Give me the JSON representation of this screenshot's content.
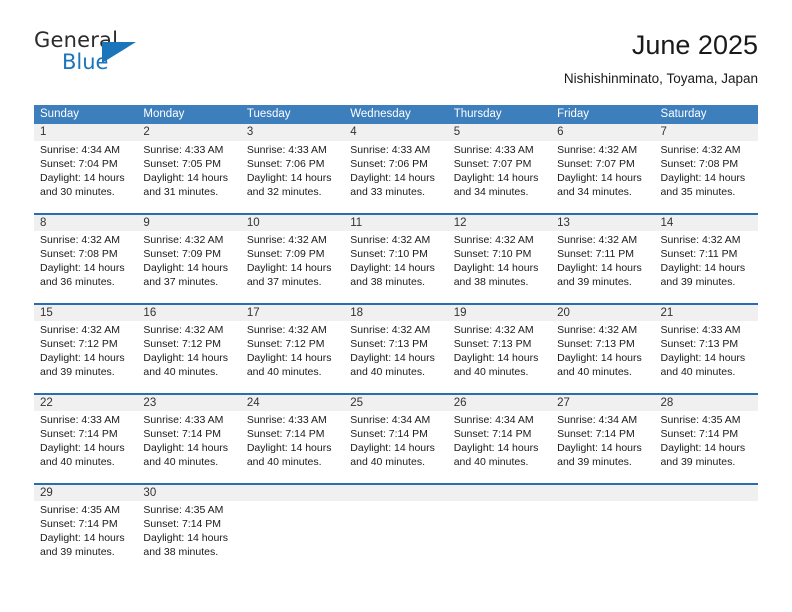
{
  "brand": {
    "name_part1": "General",
    "name_part2": "Blue",
    "accent_color": "#1b75bb"
  },
  "header": {
    "month_title": "June 2025",
    "location": "Nishishinminato, Toyama, Japan"
  },
  "calendar": {
    "header_bg": "#3d7ebd",
    "daynum_bg": "#f0f0f0",
    "row_divider": "#2a6db0",
    "weekdays": [
      "Sunday",
      "Monday",
      "Tuesday",
      "Wednesday",
      "Thursday",
      "Friday",
      "Saturday"
    ],
    "weeks": [
      {
        "days": [
          {
            "num": "1",
            "sunrise": "Sunrise: 4:34 AM",
            "sunset": "Sunset: 7:04 PM",
            "daylight1": "Daylight: 14 hours",
            "daylight2": "and 30 minutes."
          },
          {
            "num": "2",
            "sunrise": "Sunrise: 4:33 AM",
            "sunset": "Sunset: 7:05 PM",
            "daylight1": "Daylight: 14 hours",
            "daylight2": "and 31 minutes."
          },
          {
            "num": "3",
            "sunrise": "Sunrise: 4:33 AM",
            "sunset": "Sunset: 7:06 PM",
            "daylight1": "Daylight: 14 hours",
            "daylight2": "and 32 minutes."
          },
          {
            "num": "4",
            "sunrise": "Sunrise: 4:33 AM",
            "sunset": "Sunset: 7:06 PM",
            "daylight1": "Daylight: 14 hours",
            "daylight2": "and 33 minutes."
          },
          {
            "num": "5",
            "sunrise": "Sunrise: 4:33 AM",
            "sunset": "Sunset: 7:07 PM",
            "daylight1": "Daylight: 14 hours",
            "daylight2": "and 34 minutes."
          },
          {
            "num": "6",
            "sunrise": "Sunrise: 4:32 AM",
            "sunset": "Sunset: 7:07 PM",
            "daylight1": "Daylight: 14 hours",
            "daylight2": "and 34 minutes."
          },
          {
            "num": "7",
            "sunrise": "Sunrise: 4:32 AM",
            "sunset": "Sunset: 7:08 PM",
            "daylight1": "Daylight: 14 hours",
            "daylight2": "and 35 minutes."
          }
        ]
      },
      {
        "days": [
          {
            "num": "8",
            "sunrise": "Sunrise: 4:32 AM",
            "sunset": "Sunset: 7:08 PM",
            "daylight1": "Daylight: 14 hours",
            "daylight2": "and 36 minutes."
          },
          {
            "num": "9",
            "sunrise": "Sunrise: 4:32 AM",
            "sunset": "Sunset: 7:09 PM",
            "daylight1": "Daylight: 14 hours",
            "daylight2": "and 37 minutes."
          },
          {
            "num": "10",
            "sunrise": "Sunrise: 4:32 AM",
            "sunset": "Sunset: 7:09 PM",
            "daylight1": "Daylight: 14 hours",
            "daylight2": "and 37 minutes."
          },
          {
            "num": "11",
            "sunrise": "Sunrise: 4:32 AM",
            "sunset": "Sunset: 7:10 PM",
            "daylight1": "Daylight: 14 hours",
            "daylight2": "and 38 minutes."
          },
          {
            "num": "12",
            "sunrise": "Sunrise: 4:32 AM",
            "sunset": "Sunset: 7:10 PM",
            "daylight1": "Daylight: 14 hours",
            "daylight2": "and 38 minutes."
          },
          {
            "num": "13",
            "sunrise": "Sunrise: 4:32 AM",
            "sunset": "Sunset: 7:11 PM",
            "daylight1": "Daylight: 14 hours",
            "daylight2": "and 39 minutes."
          },
          {
            "num": "14",
            "sunrise": "Sunrise: 4:32 AM",
            "sunset": "Sunset: 7:11 PM",
            "daylight1": "Daylight: 14 hours",
            "daylight2": "and 39 minutes."
          }
        ]
      },
      {
        "days": [
          {
            "num": "15",
            "sunrise": "Sunrise: 4:32 AM",
            "sunset": "Sunset: 7:12 PM",
            "daylight1": "Daylight: 14 hours",
            "daylight2": "and 39 minutes."
          },
          {
            "num": "16",
            "sunrise": "Sunrise: 4:32 AM",
            "sunset": "Sunset: 7:12 PM",
            "daylight1": "Daylight: 14 hours",
            "daylight2": "and 40 minutes."
          },
          {
            "num": "17",
            "sunrise": "Sunrise: 4:32 AM",
            "sunset": "Sunset: 7:12 PM",
            "daylight1": "Daylight: 14 hours",
            "daylight2": "and 40 minutes."
          },
          {
            "num": "18",
            "sunrise": "Sunrise: 4:32 AM",
            "sunset": "Sunset: 7:13 PM",
            "daylight1": "Daylight: 14 hours",
            "daylight2": "and 40 minutes."
          },
          {
            "num": "19",
            "sunrise": "Sunrise: 4:32 AM",
            "sunset": "Sunset: 7:13 PM",
            "daylight1": "Daylight: 14 hours",
            "daylight2": "and 40 minutes."
          },
          {
            "num": "20",
            "sunrise": "Sunrise: 4:32 AM",
            "sunset": "Sunset: 7:13 PM",
            "daylight1": "Daylight: 14 hours",
            "daylight2": "and 40 minutes."
          },
          {
            "num": "21",
            "sunrise": "Sunrise: 4:33 AM",
            "sunset": "Sunset: 7:13 PM",
            "daylight1": "Daylight: 14 hours",
            "daylight2": "and 40 minutes."
          }
        ]
      },
      {
        "days": [
          {
            "num": "22",
            "sunrise": "Sunrise: 4:33 AM",
            "sunset": "Sunset: 7:14 PM",
            "daylight1": "Daylight: 14 hours",
            "daylight2": "and 40 minutes."
          },
          {
            "num": "23",
            "sunrise": "Sunrise: 4:33 AM",
            "sunset": "Sunset: 7:14 PM",
            "daylight1": "Daylight: 14 hours",
            "daylight2": "and 40 minutes."
          },
          {
            "num": "24",
            "sunrise": "Sunrise: 4:33 AM",
            "sunset": "Sunset: 7:14 PM",
            "daylight1": "Daylight: 14 hours",
            "daylight2": "and 40 minutes."
          },
          {
            "num": "25",
            "sunrise": "Sunrise: 4:34 AM",
            "sunset": "Sunset: 7:14 PM",
            "daylight1": "Daylight: 14 hours",
            "daylight2": "and 40 minutes."
          },
          {
            "num": "26",
            "sunrise": "Sunrise: 4:34 AM",
            "sunset": "Sunset: 7:14 PM",
            "daylight1": "Daylight: 14 hours",
            "daylight2": "and 40 minutes."
          },
          {
            "num": "27",
            "sunrise": "Sunrise: 4:34 AM",
            "sunset": "Sunset: 7:14 PM",
            "daylight1": "Daylight: 14 hours",
            "daylight2": "and 39 minutes."
          },
          {
            "num": "28",
            "sunrise": "Sunrise: 4:35 AM",
            "sunset": "Sunset: 7:14 PM",
            "daylight1": "Daylight: 14 hours",
            "daylight2": "and 39 minutes."
          }
        ]
      },
      {
        "days": [
          {
            "num": "29",
            "sunrise": "Sunrise: 4:35 AM",
            "sunset": "Sunset: 7:14 PM",
            "daylight1": "Daylight: 14 hours",
            "daylight2": "and 39 minutes."
          },
          {
            "num": "30",
            "sunrise": "Sunrise: 4:35 AM",
            "sunset": "Sunset: 7:14 PM",
            "daylight1": "Daylight: 14 hours",
            "daylight2": "and 38 minutes."
          },
          {
            "num": "",
            "sunrise": "",
            "sunset": "",
            "daylight1": "",
            "daylight2": ""
          },
          {
            "num": "",
            "sunrise": "",
            "sunset": "",
            "daylight1": "",
            "daylight2": ""
          },
          {
            "num": "",
            "sunrise": "",
            "sunset": "",
            "daylight1": "",
            "daylight2": ""
          },
          {
            "num": "",
            "sunrise": "",
            "sunset": "",
            "daylight1": "",
            "daylight2": ""
          },
          {
            "num": "",
            "sunrise": "",
            "sunset": "",
            "daylight1": "",
            "daylight2": ""
          }
        ]
      }
    ]
  }
}
